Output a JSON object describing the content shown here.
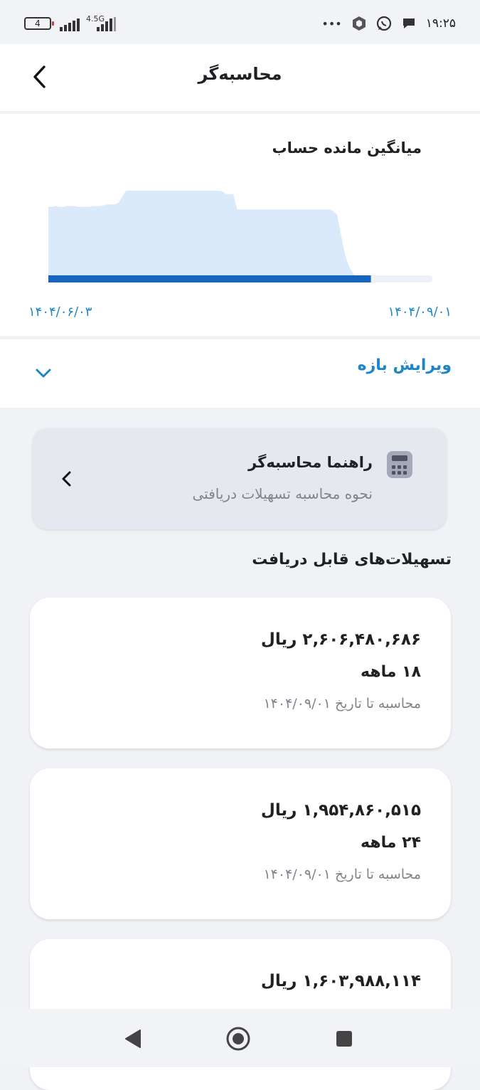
{
  "status_bar": {
    "battery_level": "4",
    "network_type": "4.5G",
    "overflow_dots": "•••",
    "time": "۱۹:۲۵",
    "icons": [
      "signal-icon",
      "data-signal-icon",
      "vpn-icon",
      "whatsapp-icon",
      "message-icon"
    ]
  },
  "app_bar": {
    "title": "محاسبه‌گر",
    "back_icon": "chevron-left-icon"
  },
  "chart_card": {
    "title": "میانگین مانده حساب",
    "start_date": "۱۴۰۴/۰۶/۰۳",
    "end_date": "۱۴۰۴/۰۹/۰۱",
    "colors": {
      "area": "#dbeafa",
      "progress": "#1565c0",
      "track": "#eef1f5",
      "date_text": "#1e86c6"
    }
  },
  "chart_data": {
    "type": "area",
    "title": "میانگین مانده حساب",
    "x_start_label": "۱۴۰۴/۰۶/۰۳",
    "x_end_label": "۱۴۰۴/۰۹/۰۱",
    "ylim": [
      0,
      1
    ],
    "grid": false,
    "legend": "none",
    "series": [
      {
        "values": [
          0.81,
          0.81,
          0.82,
          0.81,
          0.81,
          0.82,
          0.82,
          0.82,
          0.81,
          0.81,
          0.81,
          0.81,
          0.82,
          0.82,
          0.82,
          0.83,
          0.84,
          0.84,
          0.84,
          0.86,
          0.93,
          1.0,
          1.0,
          1.0,
          1.0,
          1.0,
          1.0,
          1.0,
          1.0,
          1.0,
          1.0,
          1.0,
          1.0,
          1.0,
          1.0,
          1.0,
          1.0,
          1.0,
          1.0,
          1.0,
          1.0,
          1.0,
          1.0,
          1.0,
          1.0,
          1.0,
          1.0,
          0.99,
          0.96,
          0.96,
          0.96,
          0.78,
          0.78,
          0.78,
          0.78,
          0.78,
          0.78,
          0.78,
          0.78,
          0.78,
          0.78,
          0.78,
          0.78,
          0.78,
          0.78,
          0.78,
          0.78,
          0.78,
          0.78,
          0.78,
          0.78,
          0.78,
          0.78,
          0.78,
          0.78,
          0.78,
          0.78,
          0.76,
          0.72,
          0.5,
          0.28,
          0.14,
          0.05,
          0.0
        ]
      }
    ],
    "progress_fraction": 0.84
  },
  "edit_range": {
    "label": "ویرایش بازه",
    "chevron_icon": "chevron-down-icon"
  },
  "guide_card": {
    "title": "راهنما محاسبه‌گر",
    "subtitle": "نحوه محاسبه تسهیلات دریافتی",
    "icon": "calculator-icon",
    "chevron_icon": "chevron-left-icon"
  },
  "section_title": "تسهیلات‌های قابل دریافت",
  "loans": [
    {
      "amount": "۲,۶۰۶,۴۸۰,۶۸۶ ریال",
      "term": "۱۸ ماهه",
      "note": "محاسبه تا تاریخ ۱۴۰۴/۰۹/۰۱"
    },
    {
      "amount": "۱,۹۵۴,۸۶۰,۵۱۵ ریال",
      "term": "۲۴ ماهه",
      "note": "محاسبه تا تاریخ ۱۴۰۴/۰۹/۰۱"
    },
    {
      "amount": "۱,۶۰۳,۹۸۸,۱۱۴ ریال",
      "term": "",
      "note": ""
    }
  ],
  "nav_bar": {
    "icons": [
      "back-triangle-icon",
      "home-circle-icon",
      "recents-square-icon"
    ]
  }
}
